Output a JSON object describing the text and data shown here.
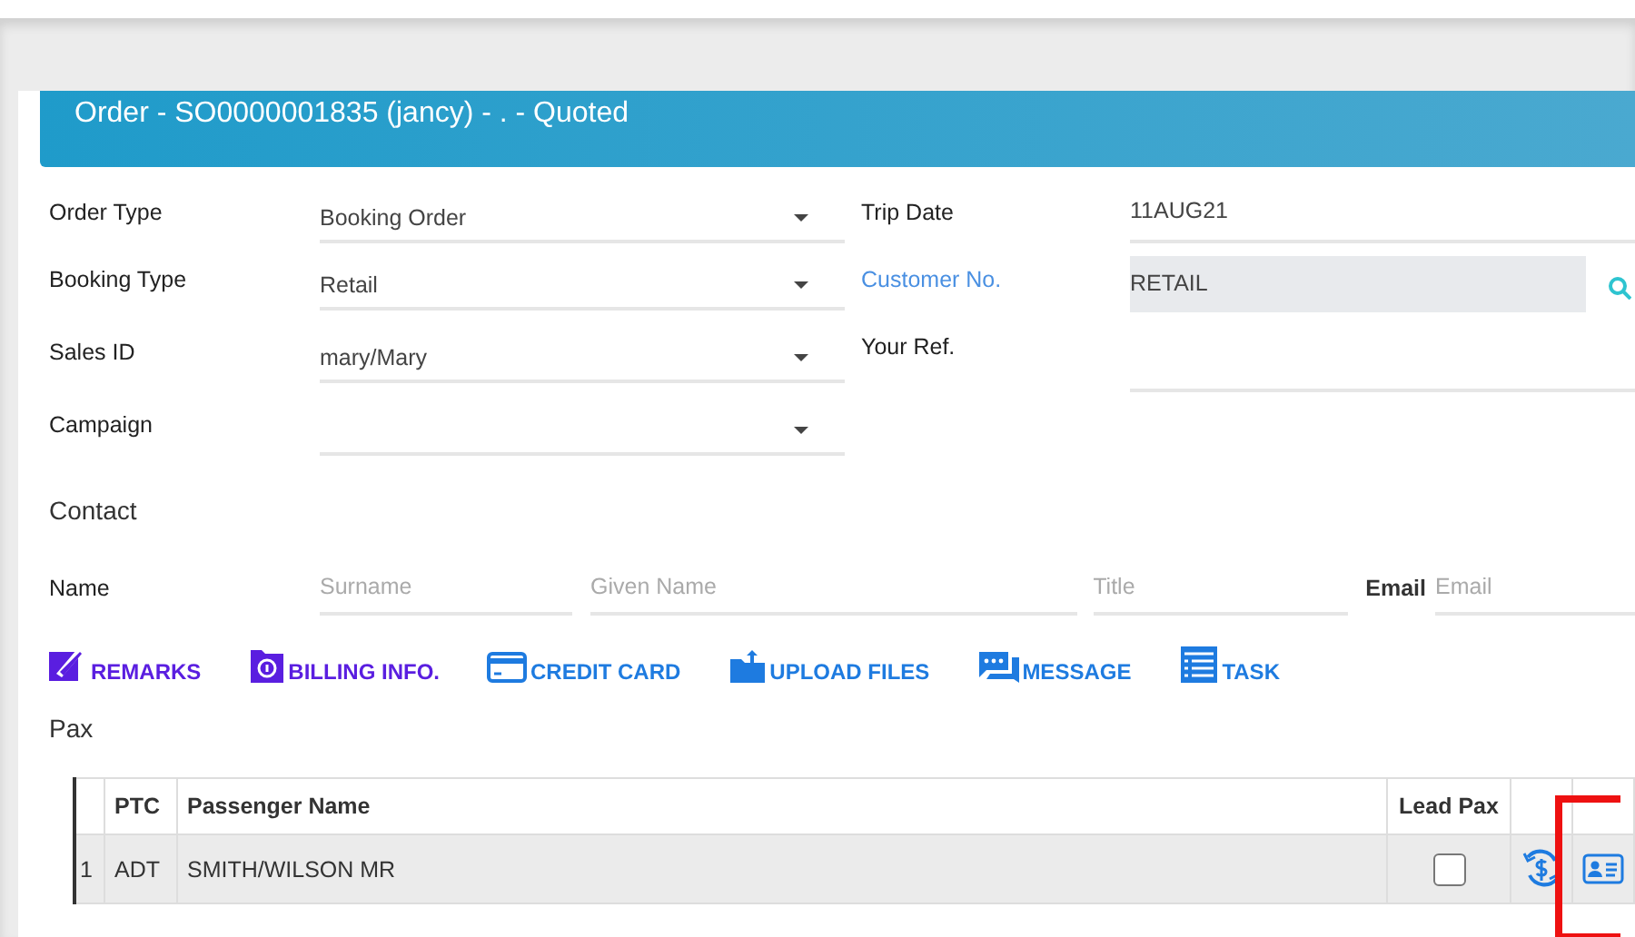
{
  "header": {
    "title": "Order - SO0000001835 (jancy) - . - Quoted"
  },
  "left_fields": [
    {
      "label": "Order Type",
      "value": "Booking Order",
      "kind": "dropdown"
    },
    {
      "label": "Booking Type",
      "value": "Retail",
      "kind": "dropdown"
    },
    {
      "label": "Sales ID",
      "value": "mary/Mary",
      "kind": "dropdown"
    },
    {
      "label": "Campaign",
      "kind": "dropdown"
    }
  ],
  "right_fields": [
    {
      "label": "Trip Date",
      "value": "11AUG21",
      "kind": "text",
      "link": false
    },
    {
      "label": "Customer No.",
      "value": "RETAIL",
      "kind": "lookup",
      "link": true
    },
    {
      "label": "Your Ref.",
      "kind": "text",
      "link": false
    }
  ],
  "contact": {
    "heading": "Contact",
    "name_label": "Name",
    "surname_placeholder": "Surname",
    "given_placeholder": "Given Name",
    "title_placeholder": "Title",
    "email_label": "Email",
    "email_placeholder": "Email"
  },
  "actions": [
    {
      "label": "REMARKS",
      "kind": "remarks",
      "color": "#5a1ee0"
    },
    {
      "label": "BILLING INFO.",
      "kind": "billing",
      "color": "#5a1ee0"
    },
    {
      "label": "CREDIT CARD",
      "kind": "card",
      "color": "#1e7be0"
    },
    {
      "label": "UPLOAD FILES",
      "kind": "upload",
      "color": "#1e7be0"
    },
    {
      "label": "MESSAGE",
      "kind": "message",
      "color": "#1e7be0"
    },
    {
      "label": "TASK",
      "kind": "task",
      "color": "#1e7be0"
    }
  ],
  "pax": {
    "heading": "Pax",
    "columns": [
      "PTC",
      "Passenger Name",
      "Lead Pax"
    ],
    "rows": [
      {
        "index": "1",
        "ptc": "ADT",
        "name": "SMITH/WILSON MR",
        "lead_pax": false,
        "profile_highlighted": true
      }
    ]
  }
}
